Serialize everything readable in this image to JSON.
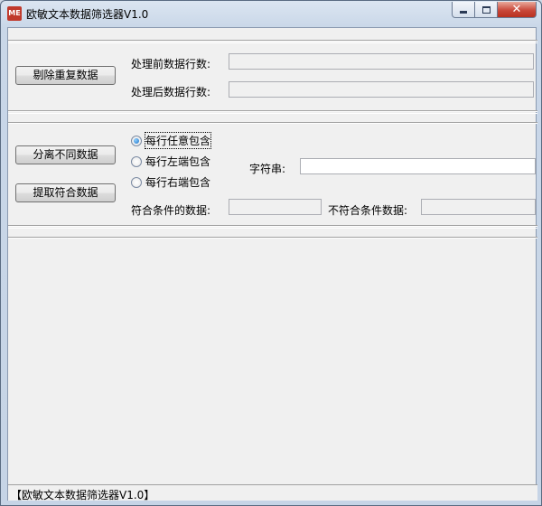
{
  "window": {
    "title": "欧敏文本数据筛选器V1.0",
    "icon": "app-logo-icon",
    "icon_text": "ME",
    "controls": {
      "minimize": "minimize-icon",
      "maximize": "maximize-icon",
      "close": "close-icon",
      "close_glyph": "✕"
    }
  },
  "section1": {
    "button_label": "剔除重复数据",
    "before_label": "处理前数据行数:",
    "before_value": "",
    "after_label": "处理后数据行数:",
    "after_value": ""
  },
  "section2": {
    "separate_button": "分离不同数据",
    "extract_button": "提取符合数据",
    "radio_options": [
      {
        "label": "每行任意包含",
        "checked": true
      },
      {
        "label": "每行左端包含",
        "checked": false
      },
      {
        "label": "每行右端包含",
        "checked": false
      }
    ],
    "string_label": "字符串:",
    "string_value": "",
    "match_label": "符合条件的数据:",
    "match_value": "",
    "nomatch_label": "不符合条件数据:",
    "nomatch_value": ""
  },
  "statusbar": {
    "text": "【欧敏文本数据筛选器V1.0】"
  }
}
